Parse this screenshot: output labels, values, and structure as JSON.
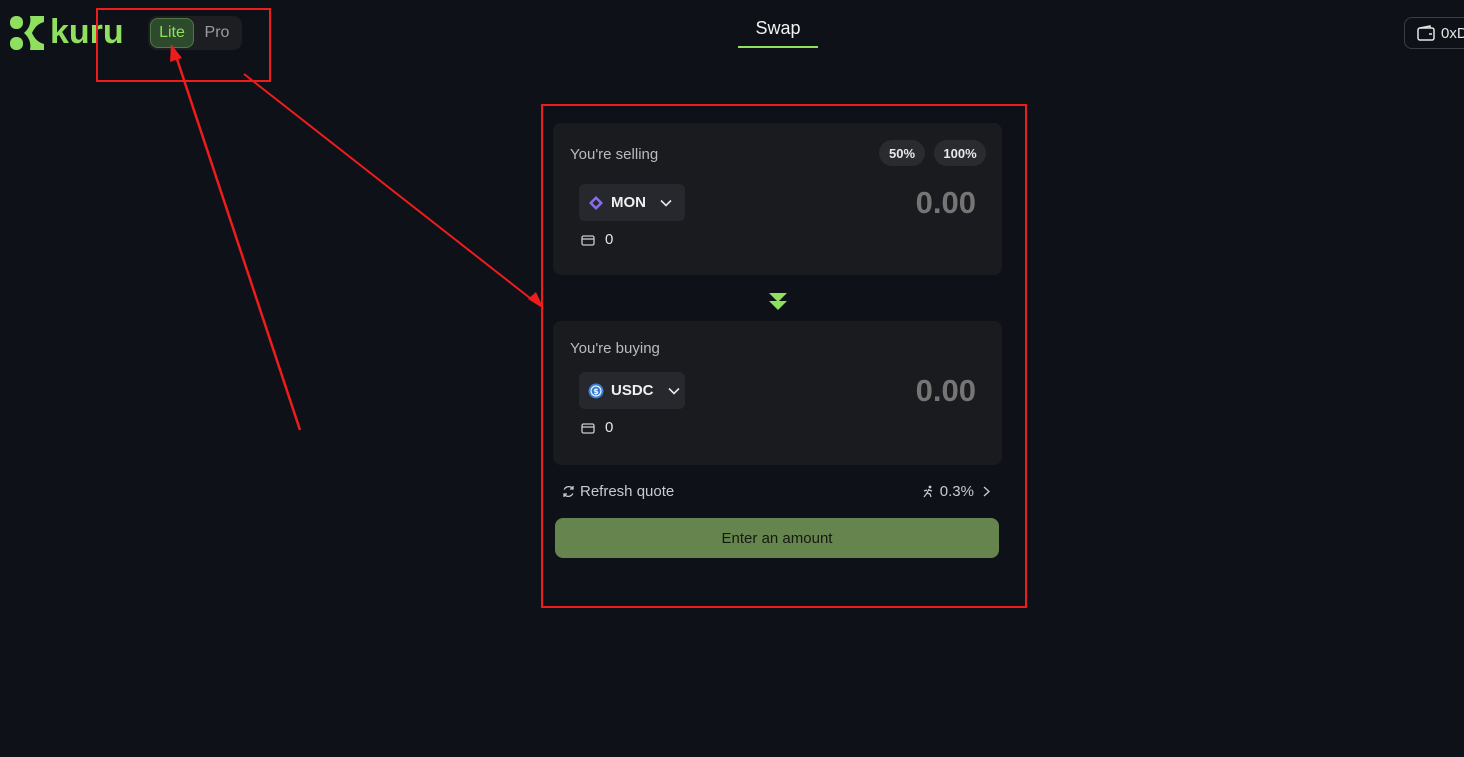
{
  "header": {
    "logo_text": "kuru",
    "mode_toggle": {
      "lite_label": "Lite",
      "pro_label": "Pro",
      "active": "Lite"
    },
    "nav_title": "Swap",
    "wallet_label": "0xD"
  },
  "swap": {
    "sell": {
      "label": "You're selling",
      "pct_50_label": "50%",
      "pct_100_label": "100%",
      "token": "MON",
      "token_icon": "monad-diamond-icon",
      "amount_placeholder": "0.00",
      "balance": "0"
    },
    "buy": {
      "label": "You're buying",
      "token": "USDC",
      "token_icon": "usdc-coin-icon",
      "amount_placeholder": "0.00",
      "balance": "0"
    },
    "refresh_label": "Refresh quote",
    "slippage": "0.3%",
    "cta_label": "Enter an amount"
  },
  "colors": {
    "background": "#0f1118",
    "accent": "#8fe05f",
    "panel": "#1a1b1e",
    "cta": "#66844e",
    "annotation": "#ee1c1c",
    "mon_purple": "#8b6cf0",
    "usdc_blue": "#3d7fd0"
  }
}
